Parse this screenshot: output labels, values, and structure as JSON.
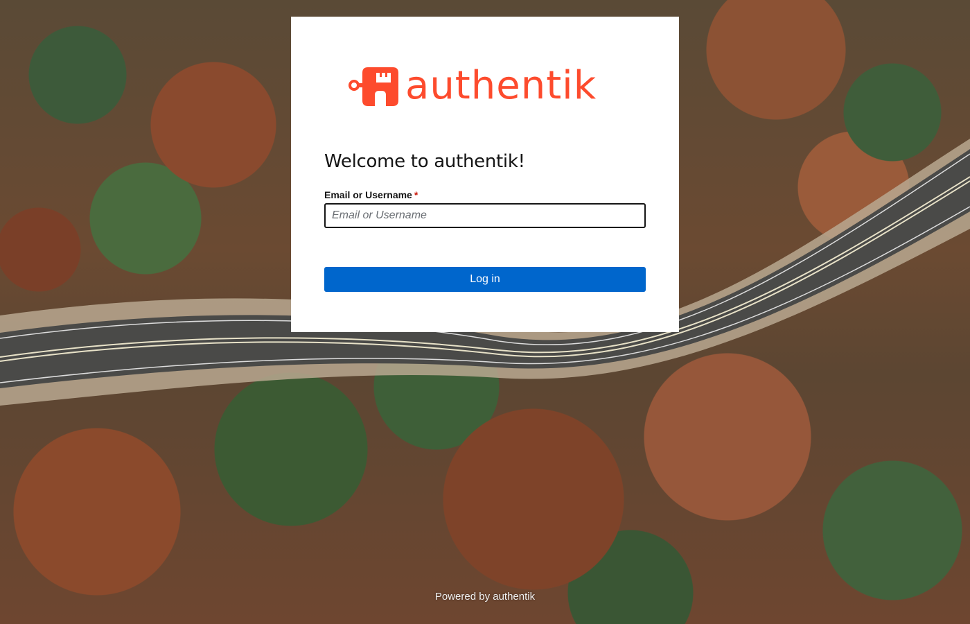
{
  "brand": {
    "name": "authentik",
    "color": "#fd4b2d"
  },
  "login": {
    "title": "Welcome to authentik!",
    "field_label": "Email or Username",
    "required_mark": "*",
    "field_placeholder": "Email or Username",
    "field_value": "",
    "submit_label": "Log in"
  },
  "footer": {
    "text": "Powered by authentik"
  },
  "colors": {
    "primary_button": "#0066cc",
    "required": "#c9190b"
  }
}
